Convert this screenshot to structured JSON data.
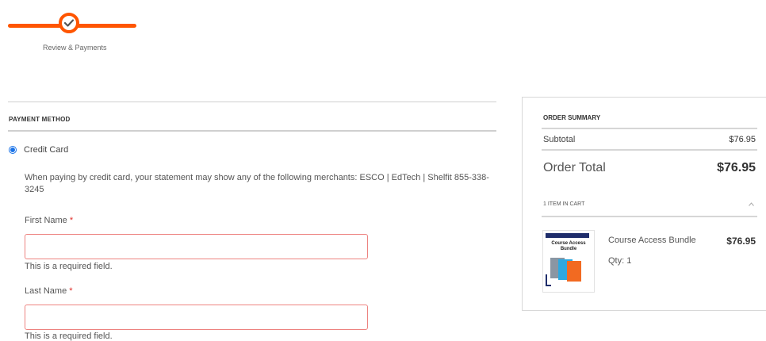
{
  "progress": {
    "step_label": "Review & Payments",
    "step_icon": "checkmark-icon",
    "accent_color": "#ff5501"
  },
  "payment": {
    "title": "PAYMENT METHOD",
    "method_label": "Credit Card",
    "method_selected": true,
    "note": "When paying by credit card, your statement may show any of the following merchants: ESCO | EdTech | Shelfit 855-338-3245",
    "first_name": {
      "label": "First Name",
      "required_mark": "*",
      "value": "",
      "error": "This is a required field."
    },
    "last_name": {
      "label": "Last Name",
      "required_mark": "*",
      "value": "",
      "error": "This is a required field."
    },
    "error_border_color": "#ed8380"
  },
  "summary": {
    "title": "ORDER SUMMARY",
    "subtotal_label": "Subtotal",
    "subtotal_value": "$76.95",
    "total_label": "Order Total",
    "total_value": "$76.95",
    "items_label": "1 ITEM IN CART",
    "items_toggle_icon": "chevron-up-icon",
    "items": [
      {
        "name": "Course Access Bundle",
        "price": "$76.95",
        "qty": "Qty: 1",
        "thumb_text": "Course Access Bundle"
      }
    ]
  }
}
